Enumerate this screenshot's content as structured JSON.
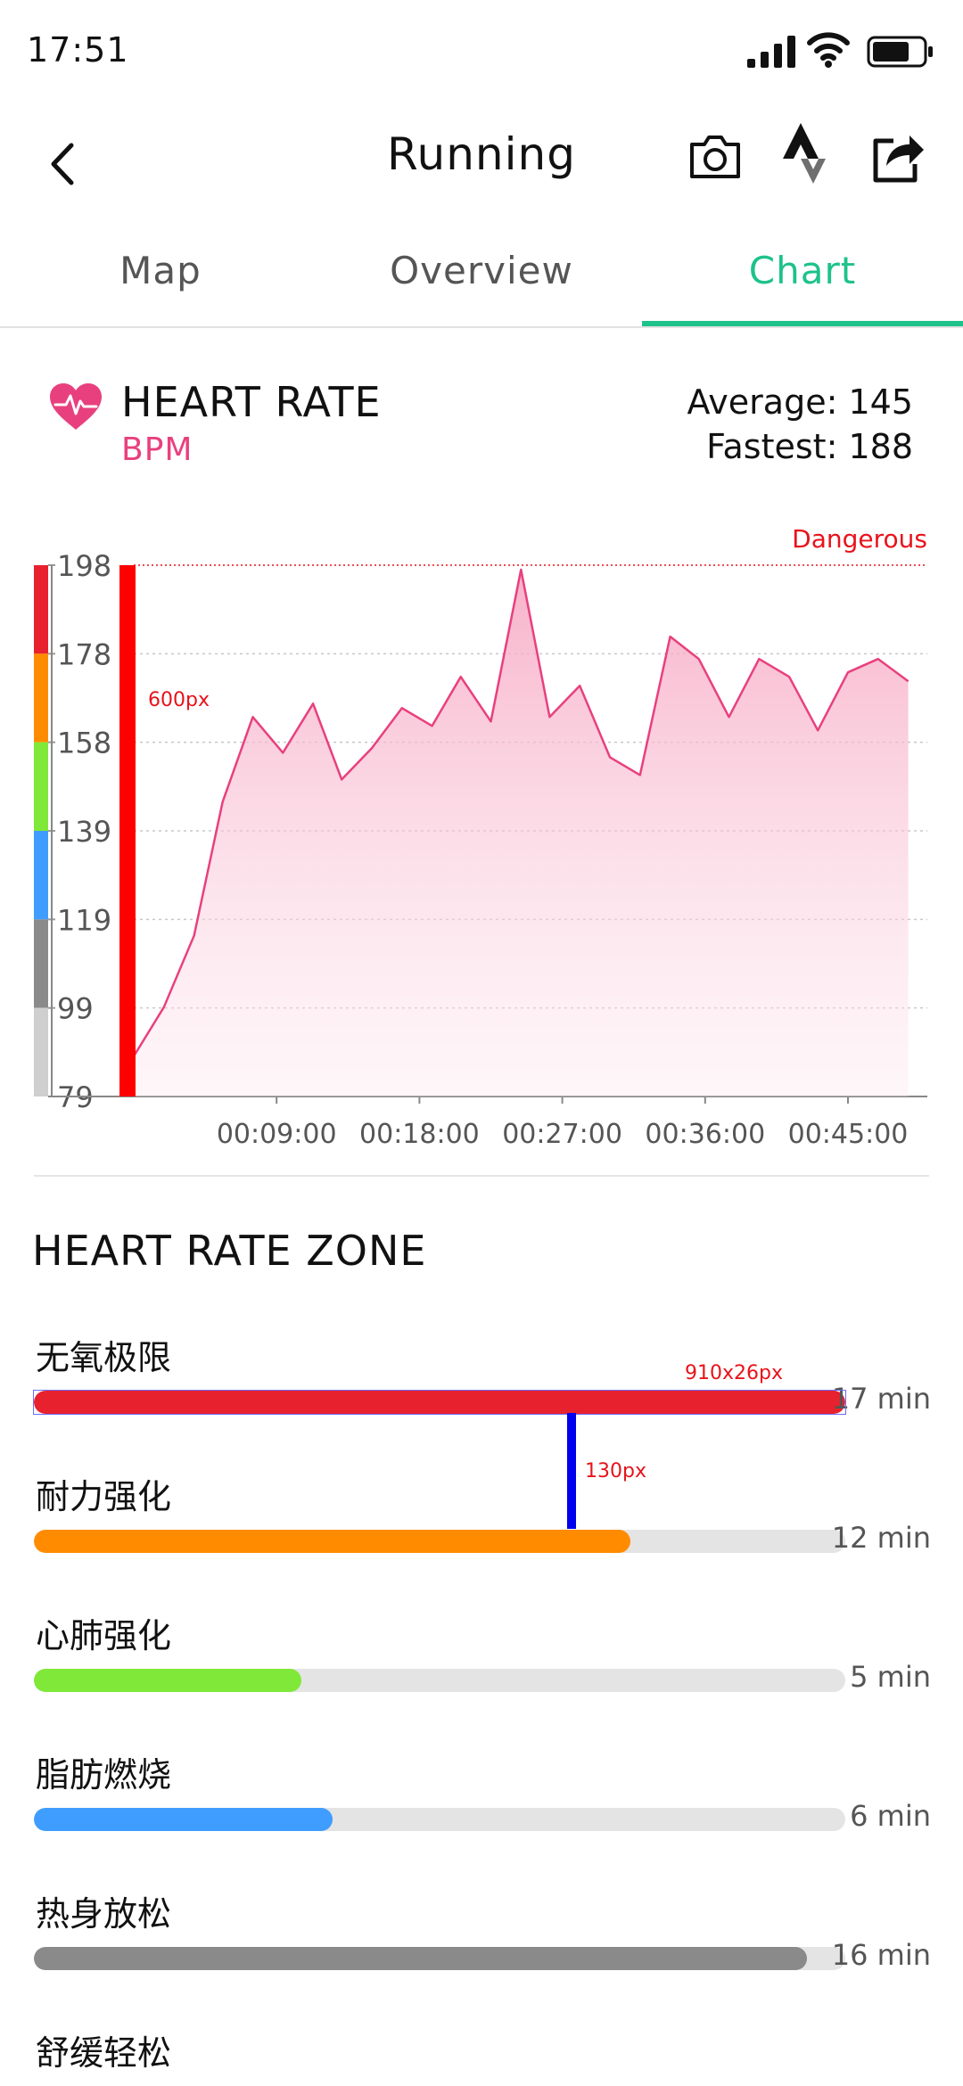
{
  "status_bar": {
    "time": "17:51"
  },
  "app_bar": {
    "title": "Running",
    "icons": [
      "back-arrow",
      "camera",
      "strava-logo",
      "share"
    ]
  },
  "tabs": [
    {
      "label": "Map",
      "active": false
    },
    {
      "label": "Overview",
      "active": false
    },
    {
      "label": "Chart",
      "active": true
    }
  ],
  "heart_rate": {
    "title": "HEART RATE",
    "unit": "BPM",
    "average_label": "Average: 145",
    "fastest_label": "Fastest: 188"
  },
  "chart_data": {
    "type": "area",
    "title": "HEART RATE",
    "ylabel": "BPM",
    "y_ticks": [
      "198",
      "178",
      "158",
      "139",
      "119",
      "99",
      "79"
    ],
    "ylim": [
      79,
      198
    ],
    "x_ticks": [
      "00:09:00",
      "00:18:00",
      "00:27:00",
      "00:36:00",
      "00:45:00"
    ],
    "x_tick_minutes": [
      9,
      18,
      27,
      36,
      45
    ],
    "xlim_minutes": [
      0,
      50
    ],
    "threshold": {
      "label": "Dangerous",
      "value": 198
    },
    "series": [
      {
        "x_minutes": [
          0,
          1.9,
          3.8,
          5.6,
          7.5,
          9.4,
          11.3,
          13.1,
          15.0,
          16.9,
          18.8,
          20.6,
          22.5,
          24.4,
          26.2,
          28.1,
          30.0,
          31.9,
          33.8,
          35.6,
          37.5,
          39.4,
          41.3,
          43.1,
          45.0,
          46.9,
          48.8
        ],
        "values": [
          88,
          99,
          115,
          145,
          164,
          156,
          167,
          150,
          157,
          166,
          162,
          173,
          163,
          197,
          164,
          171,
          155,
          151,
          182,
          177,
          164,
          177,
          173,
          161,
          174,
          177,
          172
        ]
      }
    ],
    "zone_band_colors": [
      "#e8212e",
      "#ff8c00",
      "#80e838",
      "#3f9dff",
      "#8a8a8a",
      "#cfcfcf"
    ],
    "line_color": "#e8407e",
    "grid": true
  },
  "zone_section": {
    "title": "HEART RATE ZONE",
    "zones": [
      {
        "name": "无氧极限",
        "duration": "17 min",
        "fraction": 1.0,
        "color": "#e8212e"
      },
      {
        "name": "耐力强化",
        "duration": "12 min",
        "fraction": 0.735,
        "color": "#ff8c00"
      },
      {
        "name": "心肺强化",
        "duration": "5 min",
        "fraction": 0.33,
        "color": "#80e838"
      },
      {
        "name": "脂肪燃烧",
        "duration": "6 min",
        "fraction": 0.368,
        "color": "#3f9dff"
      },
      {
        "name": "热身放松",
        "duration": "16 min",
        "fraction": 0.953,
        "color": "#8a8a8a"
      },
      {
        "name": "舒缓轻松",
        "duration": "",
        "fraction": 0,
        "color": "#cfcfcf"
      }
    ]
  },
  "annotations": {
    "chart_bar": "600px",
    "zone_bar": "910x26px",
    "zone_spacing": "130px"
  },
  "colors": {
    "accent": "#1ec28b",
    "heart": "#e8407e",
    "danger": "#e8131b"
  }
}
